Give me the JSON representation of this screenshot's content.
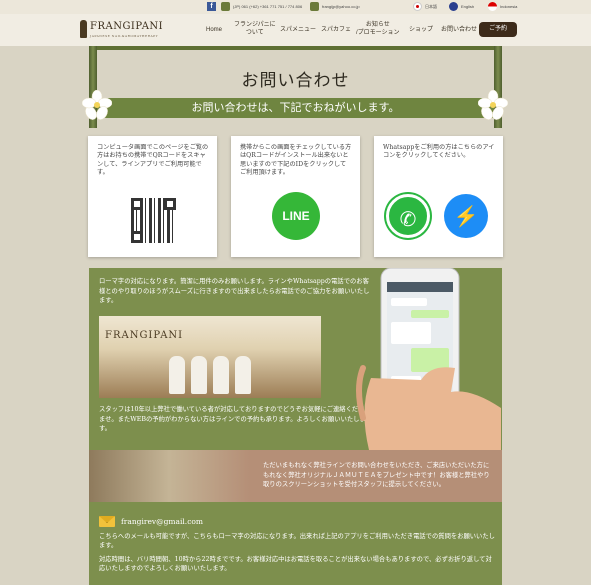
{
  "topbar": {
    "facebook_glyph": "f",
    "phone": "(JP) 061 (+62) +361 771 751 / 774 806",
    "email": "frangijp@yahoo.co.jp",
    "languages": [
      "日本語",
      "English",
      "Indonesia"
    ]
  },
  "header": {
    "logo": "FRANGIPANI",
    "logo_sub": "JAPANESE NAIL&AROMATHERAPY",
    "nav": [
      {
        "label": "Home"
      },
      {
        "label": "フランジパニに\nついて"
      },
      {
        "label": "スパメニュー"
      },
      {
        "label": "スパカフェ"
      },
      {
        "label": "お知らせ\n/プロモーション"
      },
      {
        "label": "ショップ"
      },
      {
        "label": "お問い合わせ"
      }
    ],
    "reserve_label": "ご予約"
  },
  "banner": {
    "title": "お問い合わせ",
    "subtitle": "お問い合わせは、下記でおねがいします。"
  },
  "cards": [
    {
      "text": "コンピュータ画面でこのページをご覧の方はお持ちの携帯でQRコードをスキャンして、ラインアプリでご利用可能です。"
    },
    {
      "text": "携帯からこの画面をチェックしている方はQRコードがインストール出来ないと思いますので下記のIDをクリックしてご利用頂けます。",
      "button": "LINE"
    },
    {
      "text": "Whatsappをご利用の方はこちらのアイコンをクリックしてください。"
    }
  ],
  "info": {
    "text1": "ローマ字の対応になります。簡潔に用件のみお願いします。ラインやWhatsappの電話でのお客様とのやり取りのほうがスムーズに行きますので出来ましたらお電話でのご協力をお願いいたします。",
    "shop_sign": "FRANGIPANI",
    "text2": "スタッフは10年以上弊社で働いている者が対応しておりますのでどうぞお気軽にご連絡くださいませ。またWEBの予約がわからない方はラインでの予約も承ります。よろしくお願いいたします。",
    "promo": "ただいまもれなく弊社ラインでお問い合わせをいただき、ご来店いただいた方にもれなく弊社オリジナルＪＡＭＵＴＥＡをプレゼント中です！お客様と弊社やり取りのスクリーンショットを受付スタッフに提示してください。",
    "email": "frangirev@gmail.com",
    "note1": "こちらへのメールも可能ですが、こちらもローマ字の対応になります。出来れば上記のアプリをご利用いただき電話での質問をお願いいたします。",
    "note2": "対応時間は、バリ時間朝、10時から22時までです。お客様対応中はお電話を取ることが出来ない場合もありますので、必ずお折り返して対応いたしますのでよろしくお願いいたします。"
  }
}
